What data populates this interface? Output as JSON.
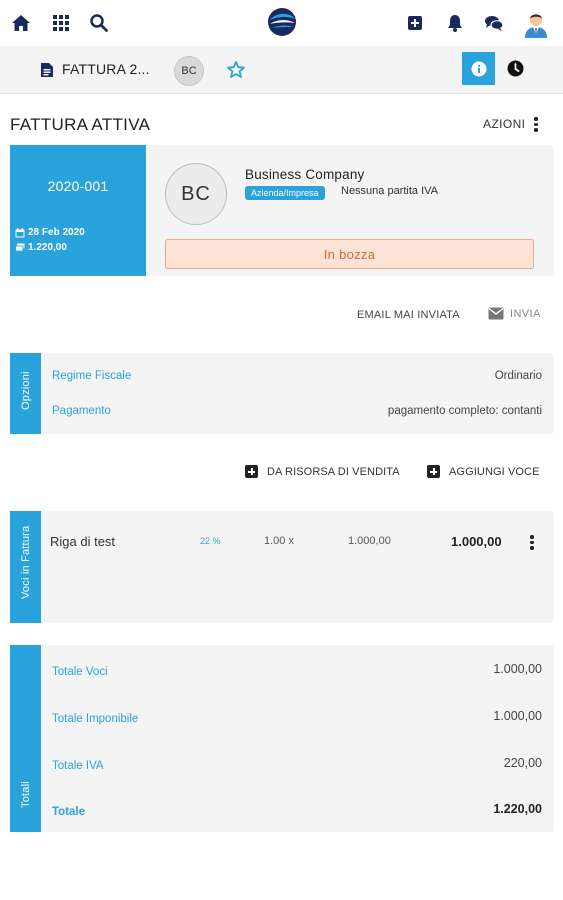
{
  "topbar": {
    "icons": [
      "home-icon",
      "grid-icon",
      "search-icon",
      "plus-square-icon",
      "bell-icon",
      "chat-icon",
      "user-avatar"
    ],
    "brand_color": "#1b2a5c"
  },
  "subheader": {
    "document_title": "FATTURA 2...",
    "contact_initials": "BC"
  },
  "page": {
    "title": "FATTURA ATTIVA",
    "actions_label": "AZIONI"
  },
  "invoice": {
    "number": "2020-001",
    "date": "28 Feb 2020",
    "amount": "1.220,00",
    "client_initials": "BC",
    "client_name": "Business Company",
    "client_type": "Azienda/Impresa",
    "vat_info": "Nessuna partita IVA",
    "status": "In bozza"
  },
  "email": {
    "status": "EMAIL MAI INVIATA",
    "send_label": "INVIA"
  },
  "options": {
    "tab_label": "Opzioni",
    "rows": [
      {
        "label": "Regime Fiscale",
        "value": "Ordinario"
      },
      {
        "label": "Pagamento",
        "value": "pagamento completo: contanti"
      }
    ]
  },
  "line_actions": {
    "from_resource": "DA RISORSA DI VENDITA",
    "add_line": "AGGIUNGI VOCE"
  },
  "lines": {
    "tab_label": "Voci in Fattura",
    "items": [
      {
        "description": "Riga di test",
        "vat": "22 %",
        "quantity": "1.00 x",
        "unit_price": "1.000,00",
        "total": "1.000,00"
      }
    ]
  },
  "totals": {
    "tab_label": "Totali",
    "rows": [
      {
        "label": "Totale Voci",
        "value": "1.000,00"
      },
      {
        "label": "Totale Imponibile",
        "value": "1.000,00"
      },
      {
        "label": "Totale IVA",
        "value": "220,00"
      },
      {
        "label": "Totale",
        "value": "1.220,00"
      }
    ]
  },
  "colors": {
    "accent": "#2aa2dc",
    "status_bg": "#fde3d5",
    "status_text": "#d9653a",
    "panel_bg": "#f4f4f4"
  }
}
